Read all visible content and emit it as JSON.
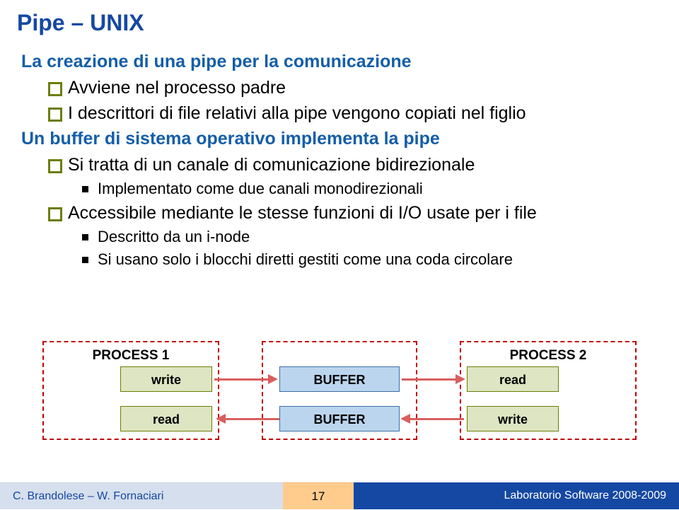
{
  "title": "Pipe – UNIX",
  "content": {
    "h1": "La creazione di una pipe per la comunicazione",
    "b1a": "Avviene nel processo padre",
    "b1b": "I descrittori di file relativi alla pipe vengono copiati nel figlio",
    "h2": "Un buffer di sistema operativo implementa la pipe",
    "b2a": "Si tratta di un canale di comunicazione bidirezionale",
    "b2a1": "Implementato come due canali monodirezionali",
    "b2b": "Accessibile mediante le stesse funzioni di I/O usate per i file",
    "b2b1": "Descritto da un i-node",
    "b2b2": "Si usano solo i blocchi diretti gestiti come una coda circolare"
  },
  "diagram": {
    "process1": "PROCESS 1",
    "process2": "PROCESS 2",
    "write": "write",
    "read": "read",
    "buffer": "BUFFER"
  },
  "footer": {
    "left": "C. Brandolese – W. Fornaciari",
    "page": "17",
    "right": "Laboratorio Software 2008-2009"
  }
}
